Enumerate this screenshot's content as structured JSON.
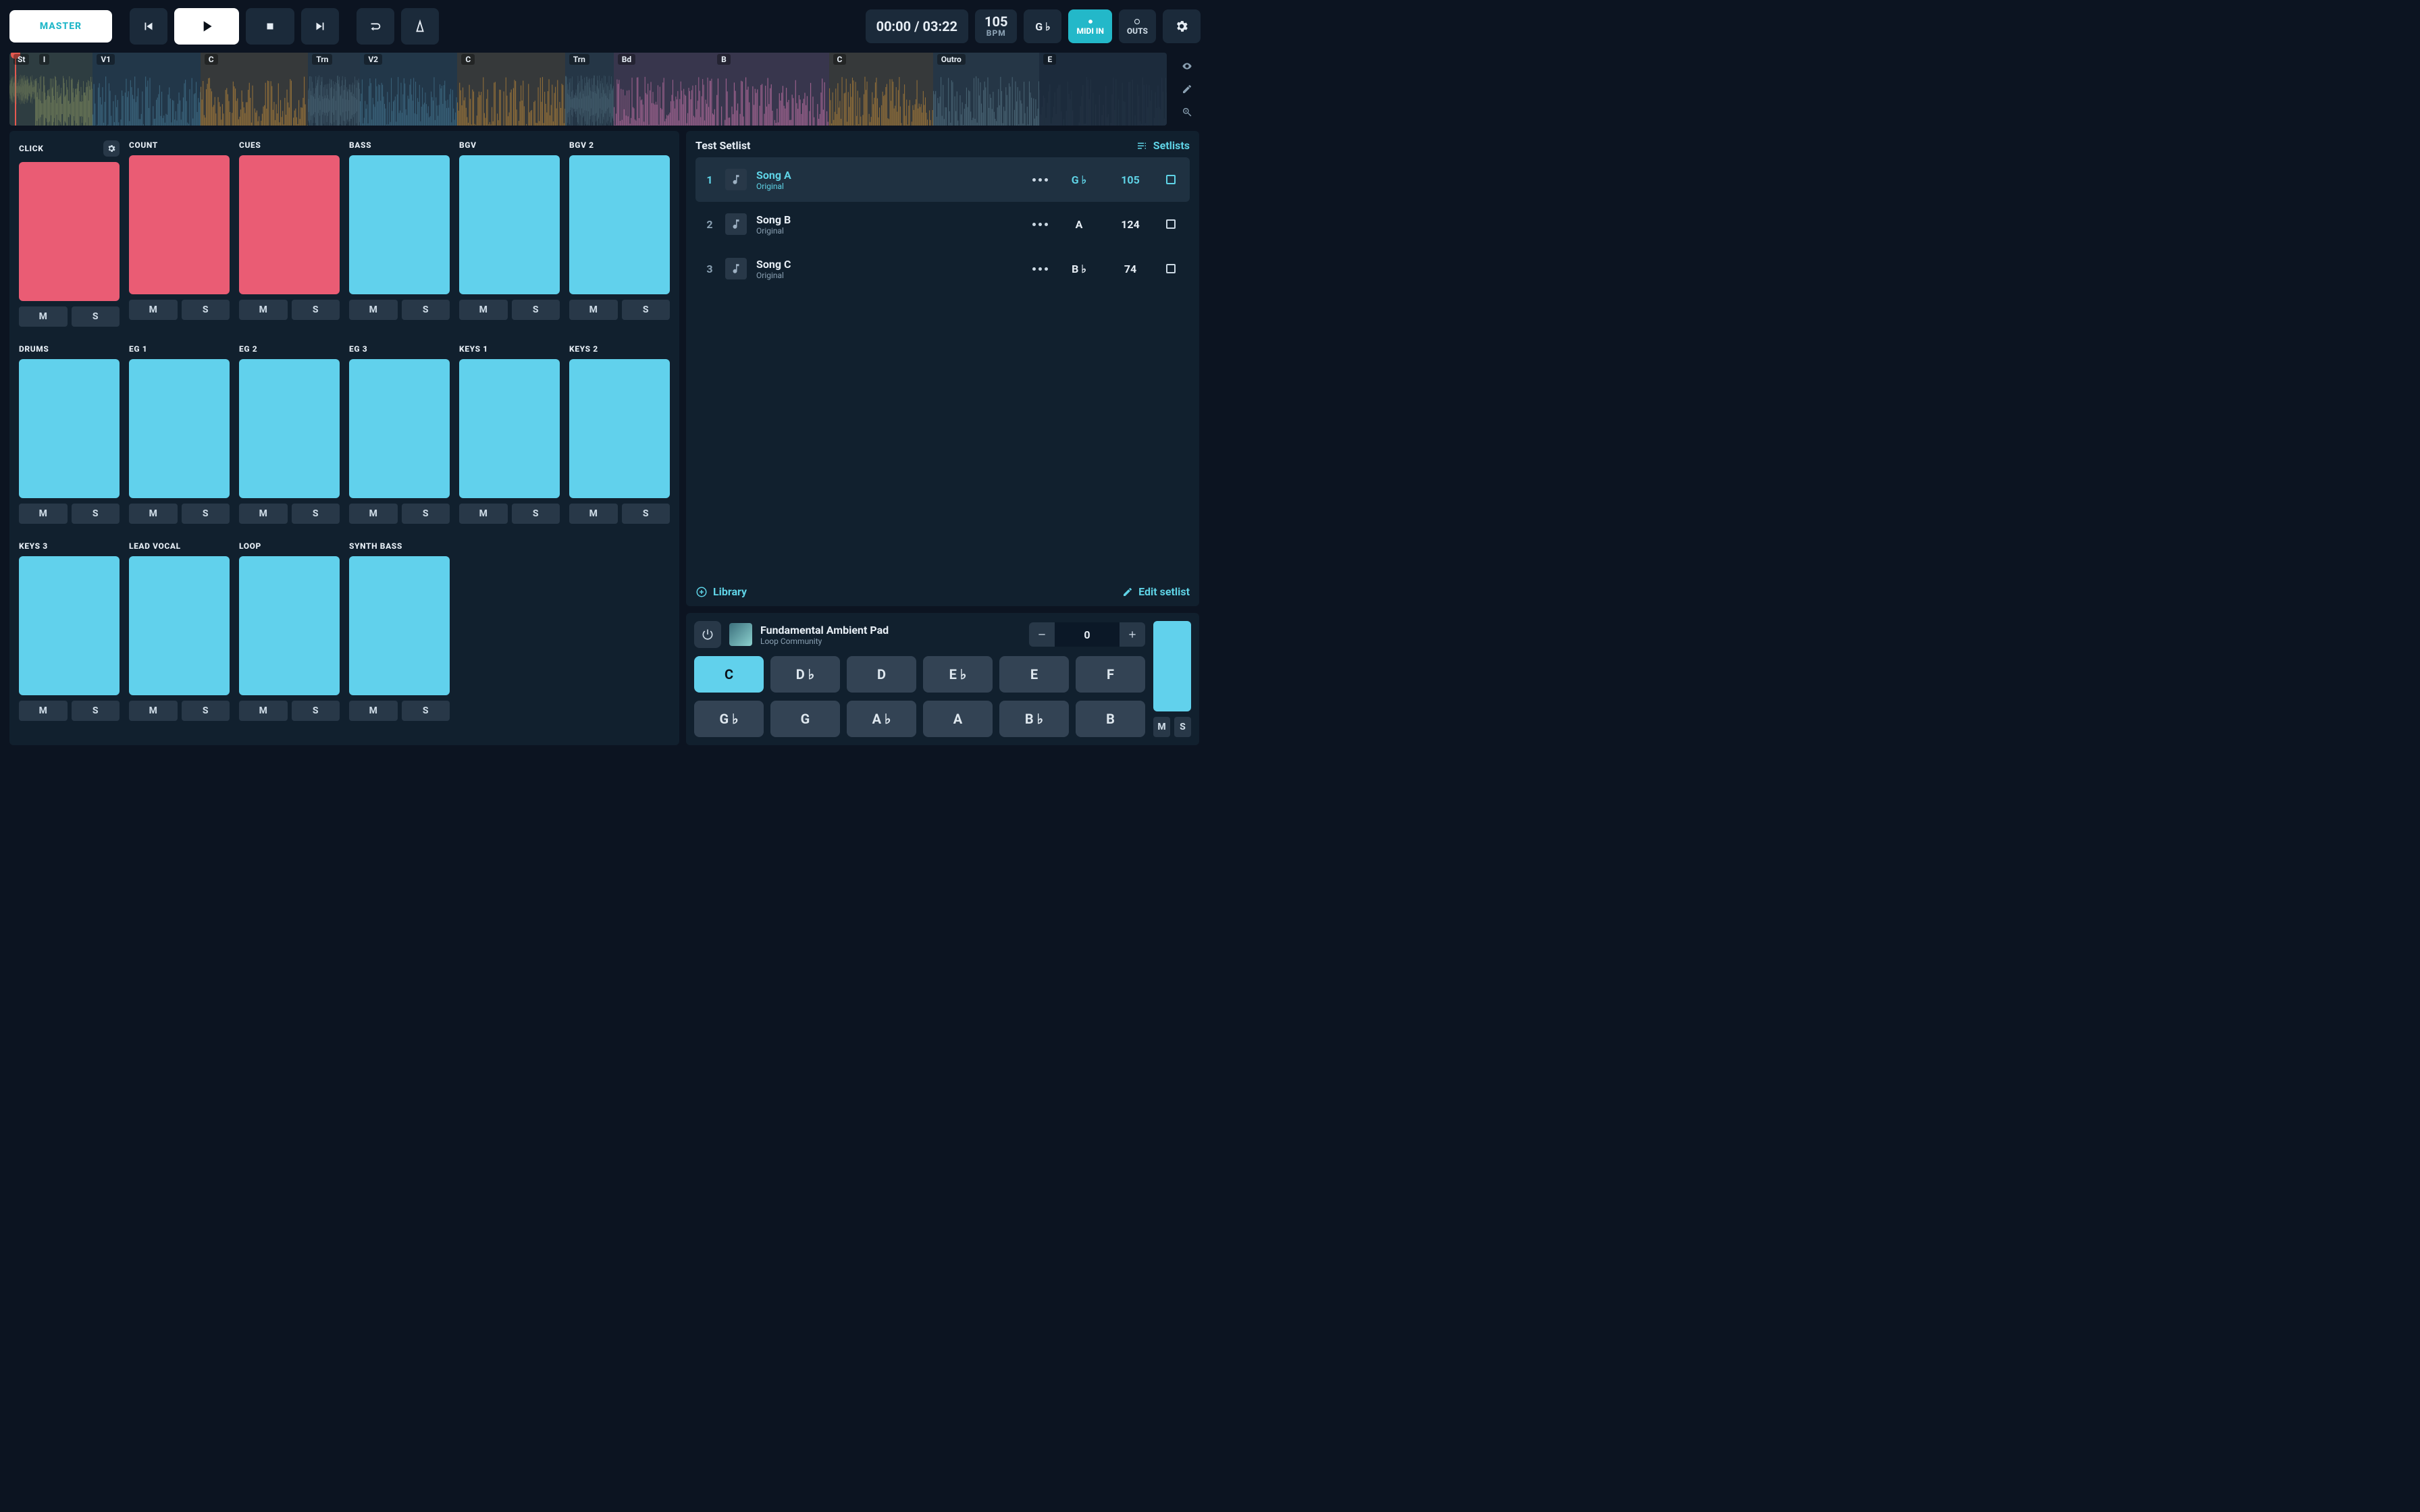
{
  "toolbar": {
    "master_label": "MASTER",
    "time": "00:00 / 03:22",
    "bpm_value": "105",
    "bpm_label": "BPM",
    "key_value": "G ♭",
    "midi_label": "MIDI IN",
    "outs_label": "OUTS"
  },
  "timeline": {
    "segments": [
      {
        "label": "St",
        "color": "#7f8b5f",
        "left_pct": 0.0,
        "width_pct": 2.2
      },
      {
        "label": "I",
        "color": "#7f8b5f",
        "left_pct": 2.2,
        "width_pct": 5.0
      },
      {
        "label": "V1",
        "color": "#3f6d86",
        "left_pct": 7.2,
        "width_pct": 9.3
      },
      {
        "label": "C",
        "color": "#a47a3a",
        "left_pct": 16.5,
        "width_pct": 9.3
      },
      {
        "label": "Trn",
        "color": "#4e6a7a",
        "left_pct": 25.8,
        "width_pct": 4.5
      },
      {
        "label": "V2",
        "color": "#3f6d86",
        "left_pct": 30.3,
        "width_pct": 8.4
      },
      {
        "label": "C",
        "color": "#a47a3a",
        "left_pct": 38.7,
        "width_pct": 9.3
      },
      {
        "label": "Trn",
        "color": "#4e6a7a",
        "left_pct": 48.0,
        "width_pct": 4.2
      },
      {
        "label": "Bd",
        "color": "#b06a9a",
        "left_pct": 52.2,
        "width_pct": 8.6
      },
      {
        "label": "B",
        "color": "#b06a9a",
        "left_pct": 60.8,
        "width_pct": 10.0
      },
      {
        "label": "C",
        "color": "#a47a3a",
        "left_pct": 70.8,
        "width_pct": 9.0
      },
      {
        "label": "Outro",
        "color": "#4e6a7a",
        "left_pct": 79.8,
        "width_pct": 9.2
      },
      {
        "label": "E",
        "color": "#243344",
        "left_pct": 89.0,
        "width_pct": 11.0
      }
    ]
  },
  "tracks": {
    "mute_label": "M",
    "solo_label": "S",
    "rows": [
      [
        "CLICK",
        "COUNT",
        "CUES",
        "BASS",
        "BGV",
        "BGV 2"
      ],
      [
        "DRUMS",
        "EG 1",
        "EG 2",
        "EG 3",
        "KEYS 1",
        "KEYS 2"
      ],
      [
        "KEYS 3",
        "LEAD VOCAL",
        "LOOP",
        "SYNTH BASS"
      ]
    ],
    "red_tracks": [
      "CLICK",
      "COUNT",
      "CUES"
    ]
  },
  "setlist": {
    "title": "Test Setlist",
    "setlists_label": "Setlists",
    "library_label": "Library",
    "edit_setlist_label": "Edit setlist",
    "songs": [
      {
        "idx": "1",
        "title": "Song A",
        "sub": "Original",
        "key": "G ♭",
        "bpm": "105",
        "active": true
      },
      {
        "idx": "2",
        "title": "Song B",
        "sub": "Original",
        "key": "A",
        "bpm": "124",
        "active": false
      },
      {
        "idx": "3",
        "title": "Song C",
        "sub": "Original",
        "key": "B ♭",
        "bpm": "74",
        "active": false
      }
    ]
  },
  "pad": {
    "title": "Fundamental Ambient Pad",
    "sub": "Loop Community",
    "stepper_value": "0",
    "mute_label": "M",
    "solo_label": "S",
    "keys_top": [
      "C",
      "D ♭",
      "D",
      "E ♭",
      "E",
      "F"
    ],
    "keys_bottom": [
      "G ♭",
      "G",
      "A ♭",
      "A",
      "B ♭",
      "B"
    ],
    "active_key": "C"
  }
}
